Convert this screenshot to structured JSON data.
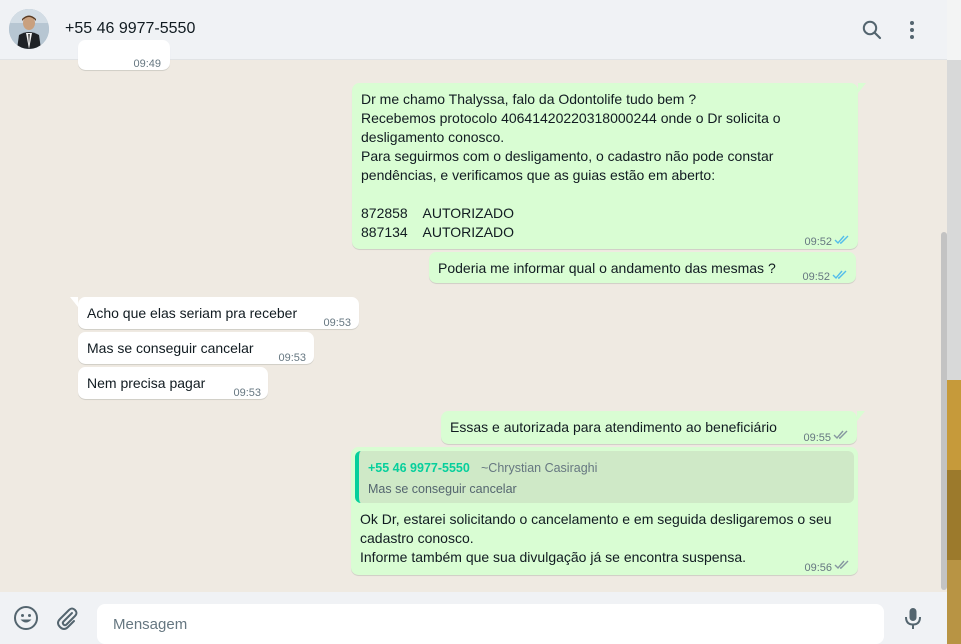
{
  "header": {
    "contact_name": "+55 46 9977-5550",
    "avatar_icon": "person-avatar",
    "search_icon": "search-icon",
    "menu_icon": "three-dots-vertical-icon"
  },
  "messages": [
    {
      "direction": "in",
      "text": "",
      "time": "09:49"
    },
    {
      "direction": "out",
      "text": "Dr me chamo Thalyssa, falo da Odontolife tudo bem ?\nRecebemos protocolo 40641420220318000244 onde o Dr solicita o\ndesligamento conosco.\nPara seguirmos com o desligamento, o cadastro não pode constar\npendências, e verificamos que as guias estão em aberto:\n\n872858    AUTORIZADO\n887134    AUTORIZADO",
      "time": "09:52",
      "status": "read"
    },
    {
      "direction": "out",
      "text": "Poderia me informar qual o andamento das mesmas ?",
      "time": "09:52",
      "status": "read"
    },
    {
      "direction": "in",
      "text": "Acho que elas seriam pra receber",
      "time": "09:53"
    },
    {
      "direction": "in",
      "text": "Mas se conseguir cancelar",
      "time": "09:53"
    },
    {
      "direction": "in",
      "text": "Nem precisa pagar",
      "time": "09:53"
    },
    {
      "direction": "out",
      "text": "Essas e autorizada para atendimento ao beneficiário",
      "time": "09:55",
      "status": "delivered"
    },
    {
      "direction": "out",
      "quote": {
        "number": "+55 46 9977-5550",
        "name": "~Chrystian Casiraghi",
        "text": "Mas se conseguir cancelar"
      },
      "text": "Ok Dr, estarei solicitando o cancelamento e em seguida desligaremos o seu\ncadastro conosco.\nInforme também que sua divulgação já se encontra suspensa.",
      "time": "09:56",
      "status": "delivered"
    }
  ],
  "footer": {
    "placeholder": "Mensagem",
    "emoji_icon": "emoji-icon",
    "attach_icon": "paperclip-icon",
    "mic_icon": "microphone-icon"
  },
  "colors": {
    "outgoing_bubble": "#d9fdd3",
    "incoming_bubble": "#ffffff",
    "read_ticks": "#53bdeb",
    "delivered_ticks": "#8696a0",
    "quote_accent": "#06cf9c"
  }
}
